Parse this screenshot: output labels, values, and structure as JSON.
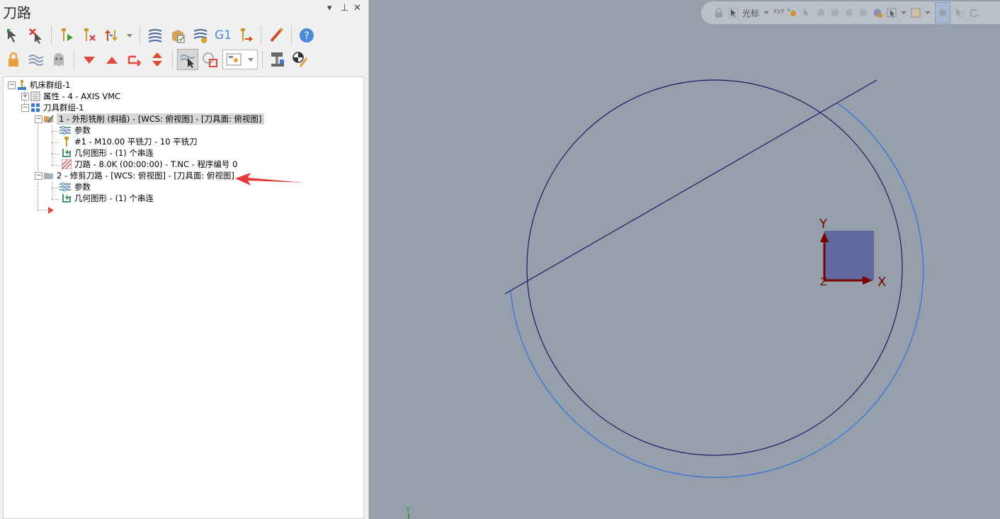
{
  "panel": {
    "title": "刀路",
    "controls": {
      "dropdown": "▾",
      "pin": "⊥",
      "close": "✕"
    }
  },
  "toolbar1": {
    "icons": [
      "select-all-operations-icon",
      "deselect-all-icon",
      "regenerate-selected-icon",
      "regenerate-dirty-icon",
      "move-operations-icon",
      "dropdown-arrow-icon",
      "toolpath-display-icon",
      "simulate-icon",
      "verify-icon",
      "post-g1-icon",
      "post-selected-icon",
      "edit-icon",
      "help-icon"
    ],
    "g1_label": "G1"
  },
  "toolbar2": {
    "icons": [
      "lock-icon",
      "wave-icon",
      "ghost-icon",
      "move-down-icon",
      "move-up-icon",
      "insert-arrow-icon",
      "expand-collapse-icon",
      "toolpath-select-icon",
      "geometry-icon",
      "display-options-icon",
      "machine-icon",
      "tool-icon"
    ]
  },
  "tree": {
    "machine_group": "机床群组-1",
    "properties": "属性 - 4 - AXIS VMC",
    "tool_group": "刀具群组-1",
    "op1": {
      "label": "1 - 外形铣削 (斜插) - [WCS: 俯视图] - [刀具面: 俯视图]",
      "params": "参数",
      "tool": "#1 - M10.00 平铣刀 - 10 平铣刀",
      "geometry": "几何图形 - (1) 个串连",
      "toolpath": "刀路 - 8.0K (00:00:00) - T.NC - 程序编号 0"
    },
    "op2": {
      "label": "2 - 修剪刀路 - [WCS: 俯视图] - [刀具面: 俯视图]",
      "params": "参数",
      "geometry": "几何图形 - (1) 个串连"
    }
  },
  "viewport": {
    "toolbar_label": "光标",
    "axis_x": "X",
    "axis_y": "Y",
    "axis_z": "Z",
    "mini_y": "Y",
    "colors": {
      "background": "#95a0ac",
      "circle": "#1a1a5e",
      "offset_arc": "#2f6fe0",
      "axis": "#7a0000",
      "axis_box": "#6068a0",
      "arrow": "#e8383a"
    }
  }
}
